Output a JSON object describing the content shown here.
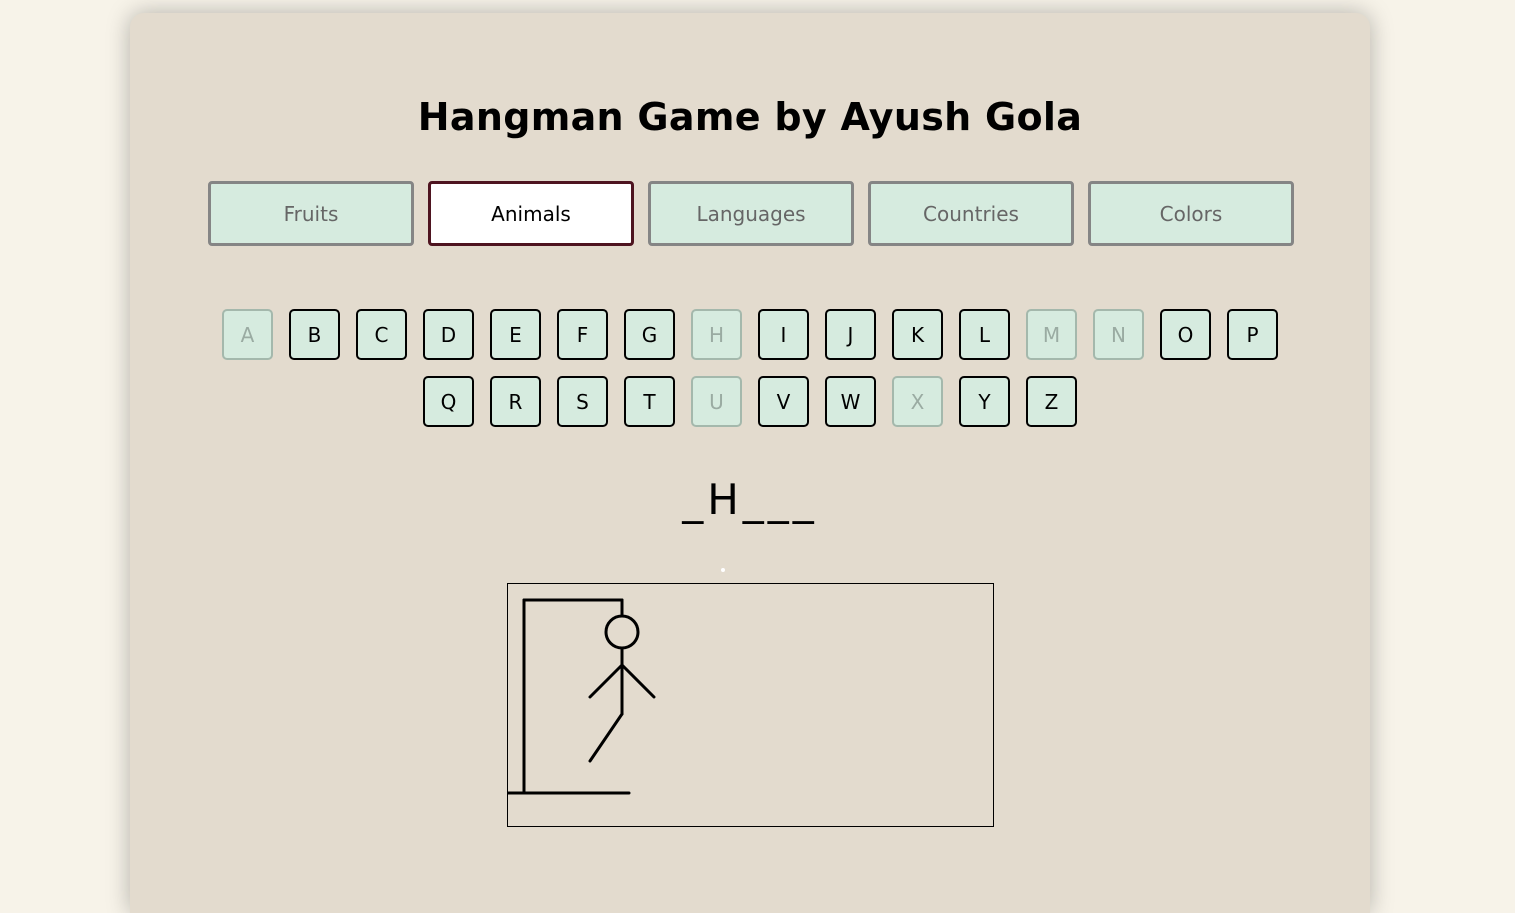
{
  "title": "Hangman Game by Ayush Gola",
  "categories": [
    {
      "label": "Fruits",
      "active": false
    },
    {
      "label": "Animals",
      "active": true
    },
    {
      "label": "Languages",
      "active": false
    },
    {
      "label": "Countries",
      "active": false
    },
    {
      "label": "Colors",
      "active": false
    }
  ],
  "keyboard": {
    "row1": [
      {
        "letter": "A",
        "used": true
      },
      {
        "letter": "B",
        "used": false
      },
      {
        "letter": "C",
        "used": false
      },
      {
        "letter": "D",
        "used": false
      },
      {
        "letter": "E",
        "used": false
      },
      {
        "letter": "F",
        "used": false
      },
      {
        "letter": "G",
        "used": false
      },
      {
        "letter": "H",
        "used": true
      },
      {
        "letter": "I",
        "used": false
      },
      {
        "letter": "J",
        "used": false
      },
      {
        "letter": "K",
        "used": false
      },
      {
        "letter": "L",
        "used": false
      },
      {
        "letter": "M",
        "used": true
      },
      {
        "letter": "N",
        "used": true
      },
      {
        "letter": "O",
        "used": false
      },
      {
        "letter": "P",
        "used": false
      }
    ],
    "row2": [
      {
        "letter": "Q",
        "used": false
      },
      {
        "letter": "R",
        "used": false
      },
      {
        "letter": "S",
        "used": false
      },
      {
        "letter": "T",
        "used": false
      },
      {
        "letter": "U",
        "used": true
      },
      {
        "letter": "V",
        "used": false
      },
      {
        "letter": "W",
        "used": false
      },
      {
        "letter": "X",
        "used": true
      },
      {
        "letter": "Y",
        "used": false
      },
      {
        "letter": "Z",
        "used": false
      }
    ]
  },
  "word_display": "_H___",
  "hangman": {
    "parts_shown": [
      "gallows",
      "head",
      "body",
      "left-arm",
      "right-arm",
      "left-leg"
    ]
  },
  "colors": {
    "page_bg": "#f7f3e9",
    "card_bg": "#e3dbce",
    "button_bg": "#d6ebdf",
    "active_border": "#4e1420"
  }
}
